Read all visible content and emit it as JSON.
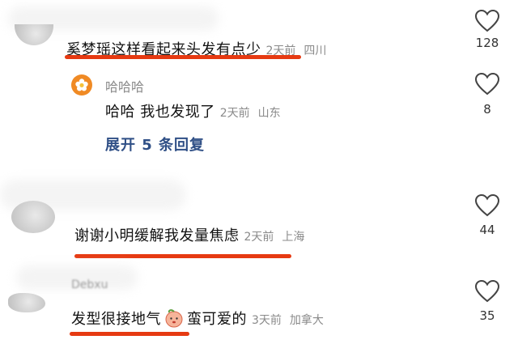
{
  "comments": [
    {
      "text": "奚梦瑶这样看起来头发有点少",
      "time": "2天前",
      "location": "四川",
      "likes": "128",
      "reply": {
        "username": "哈哈哈",
        "text": "哈哈 我也发现了",
        "time": "2天前",
        "location": "山东",
        "likes": "8"
      },
      "expand_label": "展开 5 条回复"
    },
    {
      "text": "谢谢小明缓解我发量焦虑",
      "time": "2天前",
      "location": "上海",
      "likes": "44"
    },
    {
      "handle": "Debxu",
      "text_before_emoji": "发型很接地气",
      "emoji": "peach-face-emoji",
      "text_after_emoji": "蛮可爱的",
      "time": "3天前",
      "location": "加拿大",
      "likes": "35"
    }
  ],
  "colors": {
    "underline": "#e63a12",
    "expand_link": "#2f4f86",
    "meta": "#8a8a8a",
    "avatar_orange": "#f08a24"
  },
  "icons": [
    "heart-outline-icon",
    "flower-icon"
  ]
}
